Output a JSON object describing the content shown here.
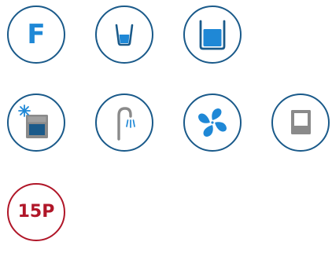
{
  "colors": {
    "ring": "#1a5a8a",
    "accent_blue": "#1f88d6",
    "gray": "#8a8a8a",
    "red": "#b01628"
  },
  "buttons": [
    {
      "icon": "f-letter-icon",
      "text": "F"
    },
    {
      "icon": "small-cup-icon"
    },
    {
      "icon": "large-container-icon"
    },
    {
      "icon": "ice-dispenser-icon"
    },
    {
      "icon": "faucet-icon"
    },
    {
      "icon": "fan-icon"
    },
    {
      "icon": "panel-icon"
    },
    {
      "icon": "15p-text-icon",
      "text": "15P"
    }
  ]
}
